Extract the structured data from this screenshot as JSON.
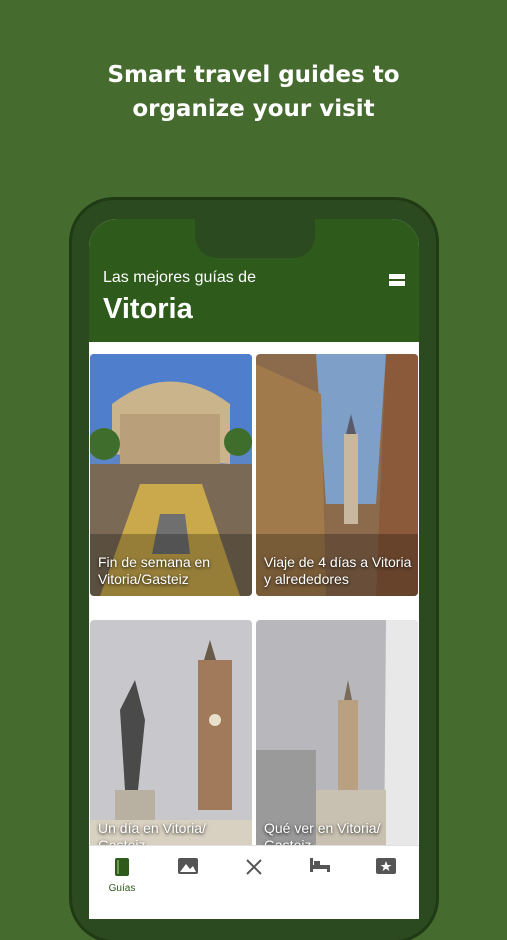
{
  "promo": {
    "line1": "Smart travel guides to",
    "line2": "organize your visit"
  },
  "header": {
    "subtitle": "Las mejores guías de",
    "city": "Vitoria"
  },
  "cards": [
    {
      "label": "Fin de semana en Vitoria/Gasteiz"
    },
    {
      "label": "Viaje de 4 días a Vitoria y alrededores"
    },
    {
      "label": "Un día en Vitoria/ Gasteiz"
    },
    {
      "label": "Qué ver en Vitoria/ Gasteiz"
    }
  ],
  "tabs": [
    {
      "name": "guides",
      "label": "Guías",
      "icon": "book-icon",
      "active": true
    },
    {
      "name": "photos",
      "label": "",
      "icon": "image-icon"
    },
    {
      "name": "food",
      "label": "",
      "icon": "fork-knife-icon"
    },
    {
      "name": "hotels",
      "label": "",
      "icon": "bed-icon"
    },
    {
      "name": "tickets",
      "label": "",
      "icon": "ticket-icon"
    }
  ],
  "colors": {
    "background": "#466b2f",
    "header": "#2e5a1c",
    "accent": "#2e5a1c"
  }
}
